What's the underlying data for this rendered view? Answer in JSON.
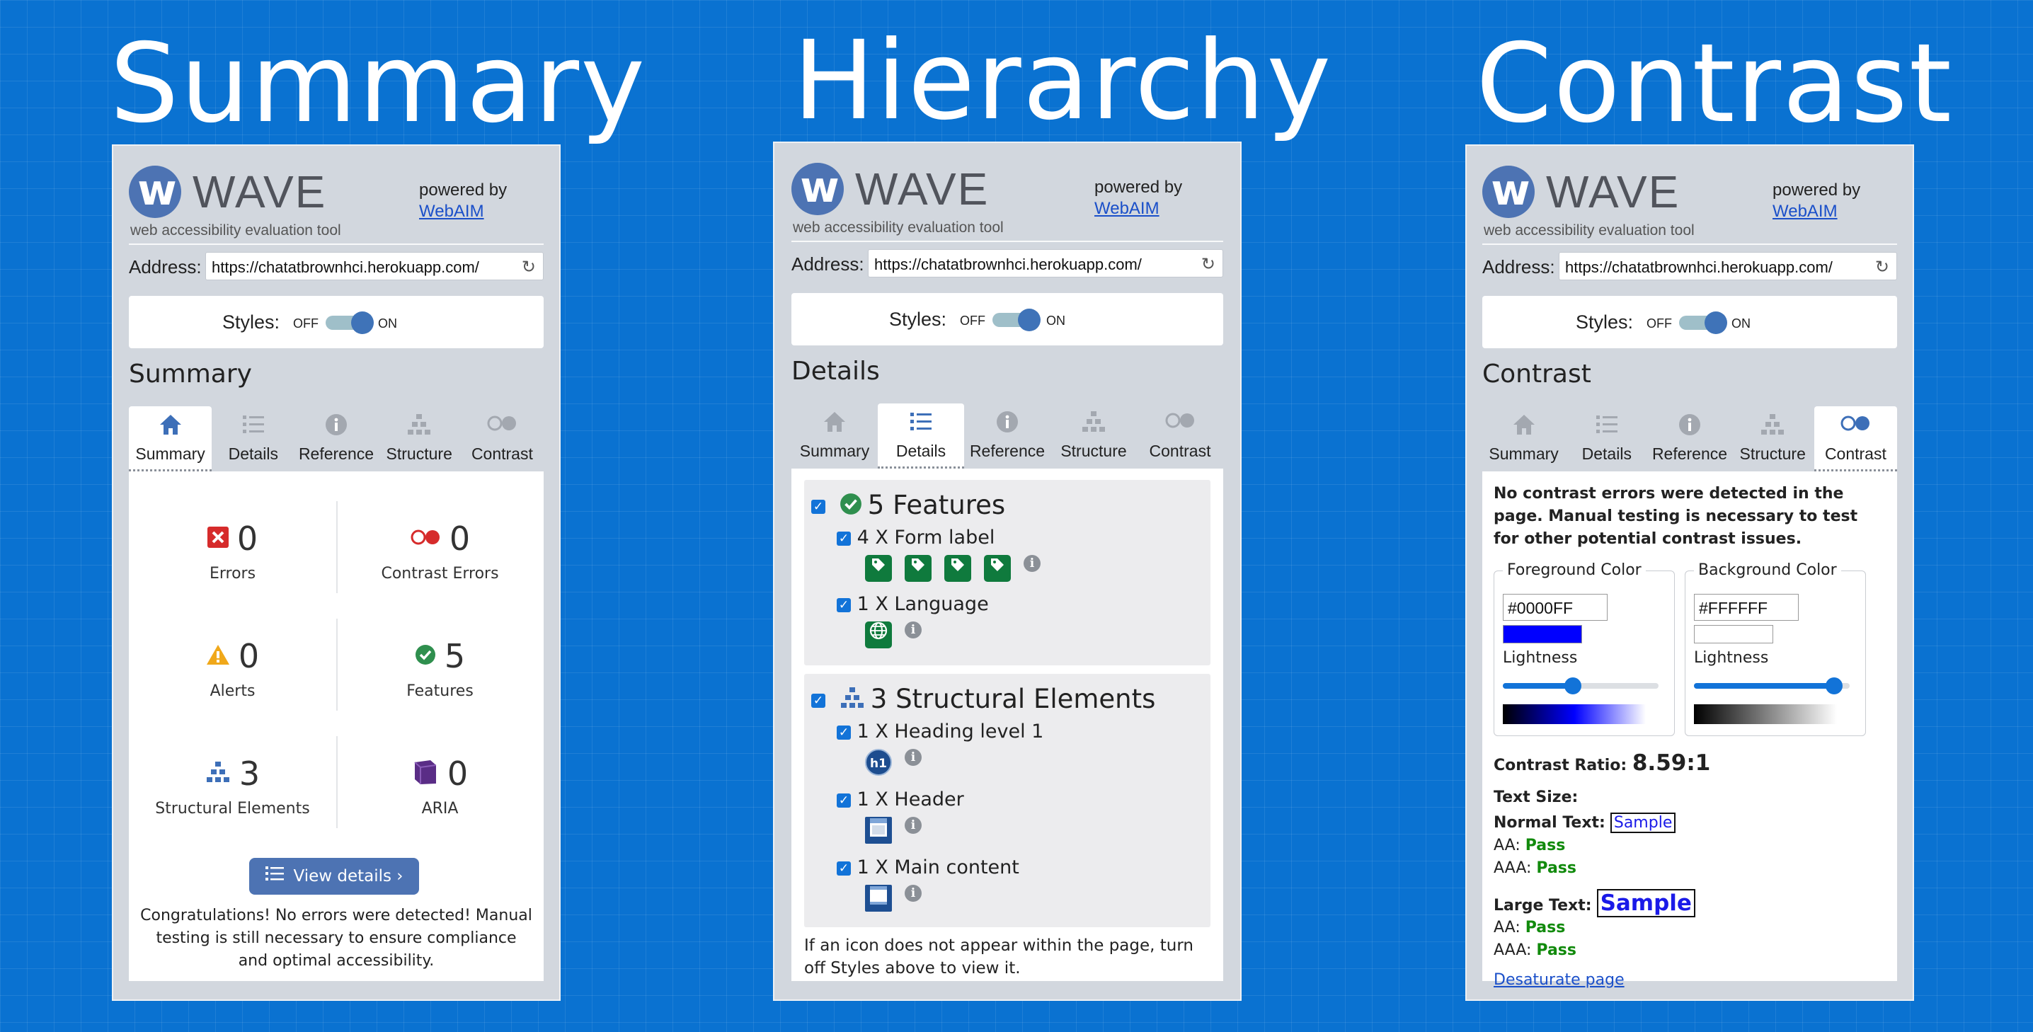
{
  "titles": {
    "summary": "Summary",
    "hierarchy": "Hierarchy",
    "contrast": "Contrast"
  },
  "wave": {
    "logo_letter": "w",
    "name": "WAVE",
    "tagline": "web accessibility evaluation tool",
    "powered_by": "powered by",
    "webaim": "WebAIM",
    "address_label": "Address:",
    "address_value": "https://chatatbrownhci.herokuapp.com/",
    "styles_label": "Styles:",
    "off": "OFF",
    "on": "ON",
    "tabs": [
      "Summary",
      "Details",
      "Reference",
      "Structure",
      "Contrast"
    ],
    "tab_icons": [
      "home-icon",
      "list-icon",
      "info-icon",
      "structure-icon",
      "contrast-icon"
    ],
    "accent_color": "#4d73b3"
  },
  "summary_panel": {
    "heading": "Summary",
    "stats": [
      {
        "value": "0",
        "label": "Errors",
        "icon": "error-icon"
      },
      {
        "value": "0",
        "label": "Contrast Errors",
        "icon": "contrast-error-icon"
      },
      {
        "value": "0",
        "label": "Alerts",
        "icon": "alert-icon"
      },
      {
        "value": "5",
        "label": "Features",
        "icon": "feature-icon"
      },
      {
        "value": "3",
        "label": "Structural Elements",
        "icon": "structure-icon"
      },
      {
        "value": "0",
        "label": "ARIA",
        "icon": "aria-icon"
      }
    ],
    "view_details": "View details ›",
    "congrats": "Congratulations! No errors were detected! Manual testing is still necessary to ensure compliance and optimal accessibility."
  },
  "details_panel": {
    "heading": "Details",
    "features": {
      "title": "5 Features",
      "items": [
        {
          "label": "4 X Form label",
          "badge_count": 4,
          "badge_icon": "tag-icon"
        },
        {
          "label": "1 X Language",
          "badge_count": 1,
          "badge_icon": "globe-icon"
        }
      ]
    },
    "structural": {
      "title": "3 Structural Elements",
      "items": [
        {
          "label": "1 X Heading level 1",
          "badge_icon": "h1-icon",
          "badge_text": "h1"
        },
        {
          "label": "1 X Header",
          "badge_icon": "header-icon"
        },
        {
          "label": "1 X Main content",
          "badge_icon": "main-content-icon"
        }
      ]
    },
    "hint": "If an icon does not appear within the page, turn off Styles above to view it."
  },
  "contrast_panel": {
    "heading": "Contrast",
    "message": "No contrast errors were detected in the page. Manual testing is necessary to test for other potential contrast issues.",
    "foreground": {
      "legend": "Foreground Color",
      "hex": "#0000FF",
      "lightness_label": "Lightness",
      "lightness": 0.5,
      "swatch_color": "#0000FF"
    },
    "background": {
      "legend": "Background Color",
      "hex": "#FFFFFF",
      "lightness_label": "Lightness",
      "lightness": 1.0,
      "swatch_color": "#FFFFFF"
    },
    "ratio_label": "Contrast Ratio:",
    "ratio_value": "8.59:1",
    "text_size_label": "Text Size:",
    "normal_text_label": "Normal Text:",
    "large_text_label": "Large Text:",
    "sample": "Sample",
    "aa_label": "AA:",
    "aaa_label": "AAA:",
    "pass": "Pass",
    "desaturate": "Desaturate page"
  }
}
